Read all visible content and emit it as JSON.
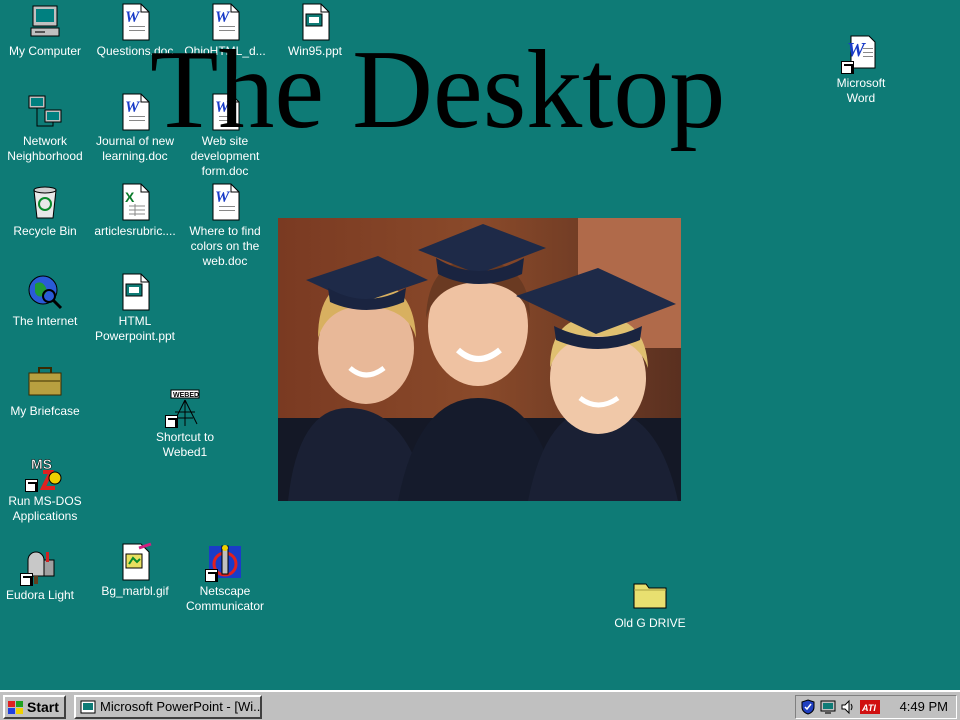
{
  "slide_title": "The Desktop",
  "icons": {
    "my_computer": "My Computer",
    "network": "Network\nNeighborhood",
    "recycle": "Recycle Bin",
    "internet": "The Internet",
    "briefcase": "My Briefcase",
    "msdos": "Run MS-DOS\nApplications",
    "eudora": "Eudora Light",
    "questions": "Questions.doc",
    "journal": "Journal of new\nlearning.doc",
    "articles": "articlesrubric....",
    "html_ppt": "HTML\nPowerpoint.ppt",
    "bg_marbl": "Bg_marbl.gif",
    "ohiohtml": "OhioHTML_d...",
    "website_form": "Web site\ndevelopment\nform.doc",
    "where_colors": "Where to find\ncolors on the\nweb.doc",
    "webed": "Shortcut to\nWebed1",
    "netscape": "Netscape\nCommunicator",
    "win95": "Win95.ppt",
    "word": "Microsoft\nWord",
    "old_g": "Old G DRIVE"
  },
  "icon_glyph_text": {
    "ms_dos": "MS",
    "webed": "WEBED"
  },
  "taskbar": {
    "start": "Start",
    "task": "Microsoft PowerPoint - [Wi...",
    "clock": "4:49 PM",
    "ati": "ATI"
  },
  "colors": {
    "desktop": "#0e7b76",
    "taskbar": "#c0c0c0"
  }
}
